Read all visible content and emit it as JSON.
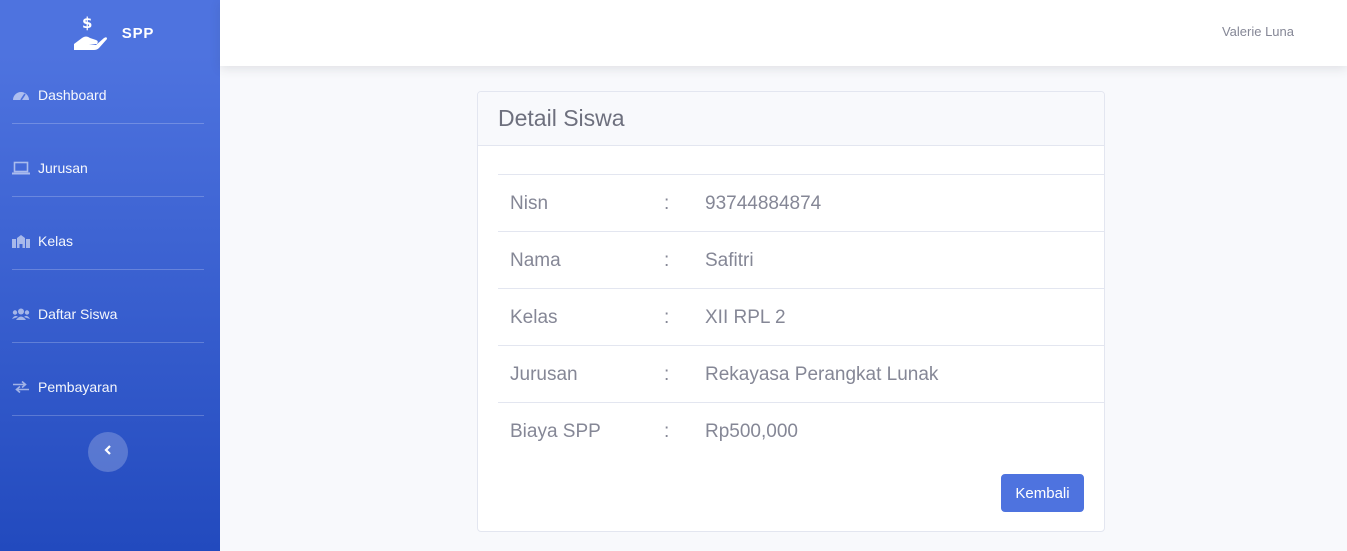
{
  "brand": {
    "name": "SPP",
    "icon": "hand-holding-dollar-icon"
  },
  "sidebar": {
    "items": [
      {
        "label": "Dashboard",
        "icon": "tachometer-icon"
      },
      {
        "label": "Jurusan",
        "icon": "laptop-icon"
      },
      {
        "label": "Kelas",
        "icon": "school-icon"
      },
      {
        "label": "Daftar Siswa",
        "icon": "users-icon"
      },
      {
        "label": "Pembayaran",
        "icon": "exchange-icon"
      }
    ],
    "toggle_icon": "chevron-left-icon"
  },
  "topbar": {
    "user_name": "Valerie Luna"
  },
  "card": {
    "title": "Detail Siswa",
    "separator": ":",
    "rows": [
      {
        "label": "Nisn",
        "value": "93744884874"
      },
      {
        "label": "Nama",
        "value": "Safitri"
      },
      {
        "label": "Kelas",
        "value": "XII RPL 2"
      },
      {
        "label": "Jurusan",
        "value": "Rekayasa Perangkat Lunak"
      },
      {
        "label": "Biaya SPP",
        "value": "Rp500,000"
      }
    ],
    "back_button": "Kembali"
  },
  "colors": {
    "primary": "#4e73df",
    "primary_dark": "#224abe",
    "text_muted": "#858796",
    "background": "#f8f9fc"
  }
}
